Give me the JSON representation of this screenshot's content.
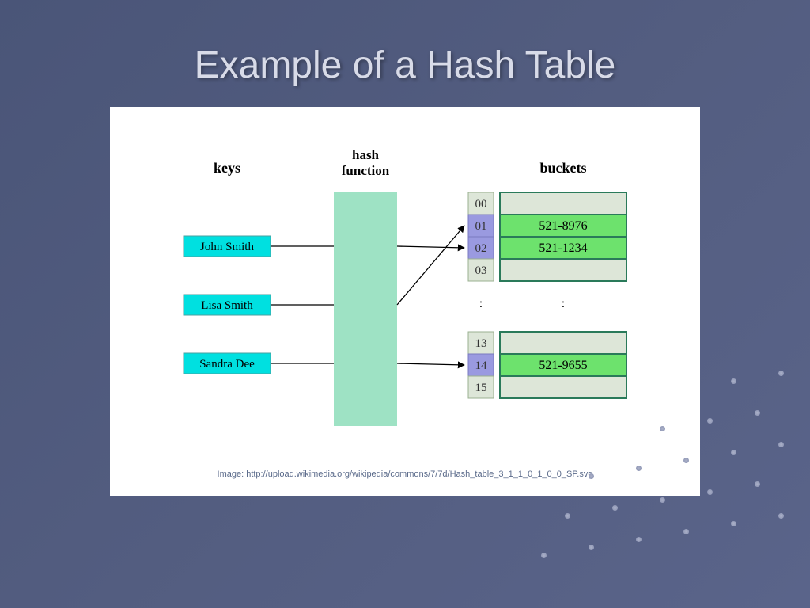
{
  "title": "Example of a Hash Table",
  "headers": {
    "keys": "keys",
    "hash_line1": "hash",
    "hash_line2": "function",
    "buckets": "buckets"
  },
  "keys": [
    {
      "label": "John Smith"
    },
    {
      "label": "Lisa Smith"
    },
    {
      "label": "Sandra Dee"
    }
  ],
  "buckets_top": [
    {
      "index": "00",
      "value": "",
      "highlight": false
    },
    {
      "index": "01",
      "value": "521-8976",
      "highlight": true
    },
    {
      "index": "02",
      "value": "521-1234",
      "highlight": true
    },
    {
      "index": "03",
      "value": "",
      "highlight": false
    }
  ],
  "ellipsis": ":",
  "buckets_bottom": [
    {
      "index": "13",
      "value": "",
      "highlight": false
    },
    {
      "index": "14",
      "value": "521-9655",
      "highlight": true
    },
    {
      "index": "15",
      "value": "",
      "highlight": false
    }
  ],
  "mappings": [
    {
      "key": "John Smith",
      "bucket_index": "02"
    },
    {
      "key": "Lisa Smith",
      "bucket_index": "01"
    },
    {
      "key": "Sandra Dee",
      "bucket_index": "14"
    }
  ],
  "caption": "Image: http://upload.wikimedia.org/wikipedia/commons/7/7d/Hash_table_3_1_1_0_1_0_0_SP.svg",
  "colors": {
    "key_fill": "#00e0e0",
    "key_stroke": "#4aa0a0",
    "hashfn_fill": "#9ee2c4",
    "idx_fill": "#dde6d8",
    "idx_highlight": "#9a9ae0",
    "bucket_fill": "#dde6d8",
    "bucket_highlight": "#6de26d",
    "bucket_stroke": "#2a7a5a"
  }
}
